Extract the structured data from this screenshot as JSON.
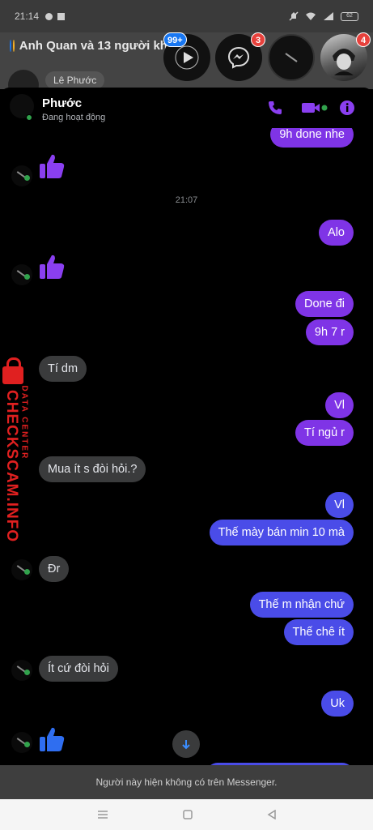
{
  "status_bar": {
    "time": "21:14",
    "battery": "62"
  },
  "background_chat": {
    "group_title": "Anh Quan và 13 người kh",
    "member_name": "Lê Phước"
  },
  "chat_heads": [
    {
      "name": "video-head",
      "badge": "99+"
    },
    {
      "name": "messenger-head",
      "badge": "3"
    },
    {
      "name": "active-contact-head",
      "badge": ""
    },
    {
      "name": "anime-avatar-head",
      "badge": "4"
    }
  ],
  "chat": {
    "contact_name": "Phước",
    "contact_status": "Đang hoạt động",
    "timestamp": "21:07",
    "messages": [
      {
        "from": "me",
        "text": "9h done nhe"
      },
      {
        "from": "them",
        "type": "like"
      },
      {
        "from": "me",
        "text": "Alo"
      },
      {
        "from": "them",
        "type": "like"
      },
      {
        "from": "me",
        "text": "Done đi"
      },
      {
        "from": "me",
        "text": "9h 7 r"
      },
      {
        "from": "them",
        "text": "Tí dm"
      },
      {
        "from": "me",
        "text": "Vl"
      },
      {
        "from": "me",
        "text": "Tí ngủ r"
      },
      {
        "from": "them",
        "text": "Mua ít s đòi hỏi.?"
      },
      {
        "from": "me",
        "text": "Vl"
      },
      {
        "from": "me",
        "text": "Thế mày bán min 10 mà"
      },
      {
        "from": "them",
        "text": "Đr"
      },
      {
        "from": "me",
        "text": "Thế m nhận chứ"
      },
      {
        "from": "me",
        "text": "Thế chê ít"
      },
      {
        "from": "them",
        "text": "Ít cứ đòi hỏi"
      },
      {
        "from": "me",
        "text": "Uk"
      },
      {
        "from": "them",
        "type": "like"
      }
    ]
  },
  "watermark": {
    "brand": "CHECKSCAM.INFO",
    "tagline": "DATA CENTER"
  },
  "banner": {
    "text": "Người này hiện không có trên Messenger."
  },
  "colors": {
    "accent": "#7f34e6",
    "blue_bubble": "#4a4ce8",
    "online": "#31a24c",
    "badge": "#e8413c",
    "watermark": "#e02020"
  }
}
